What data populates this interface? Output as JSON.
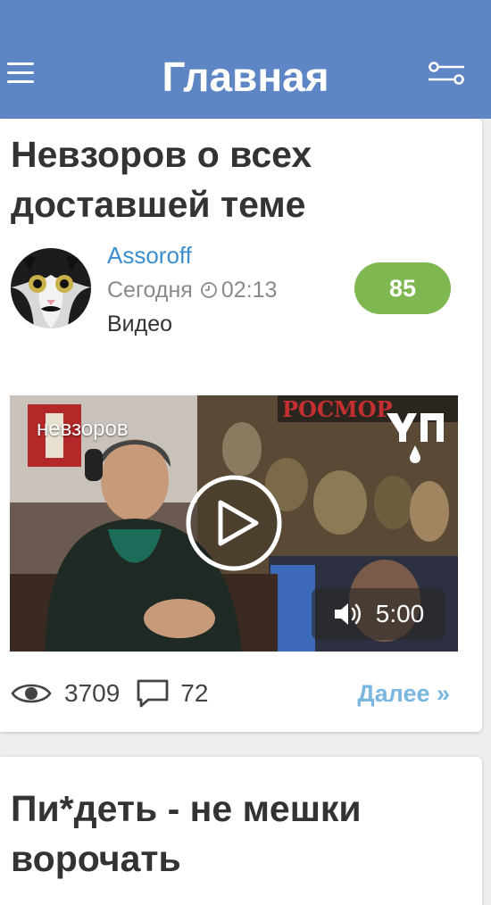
{
  "header": {
    "title": "Главная",
    "menu_icon": "hamburger-icon",
    "filter_icon": "filter-sliders-icon",
    "background_color": "#5f86c4"
  },
  "posts": [
    {
      "title": "Невзоров о всех доставшей теме",
      "author": "Assoroff",
      "date": "Сегодня",
      "time": "02:13",
      "category": "Видео",
      "score": "85",
      "video": {
        "caption": "невзоров",
        "duration": "5:00"
      },
      "views": "3709",
      "comments": "72",
      "more_label": "Далее »"
    },
    {
      "title": "Пи*деть - не мешки ворочать"
    }
  ],
  "colors": {
    "author": "#3b8fd0",
    "score_badge": "#7fb751",
    "more_link": "#7ab7e0"
  }
}
